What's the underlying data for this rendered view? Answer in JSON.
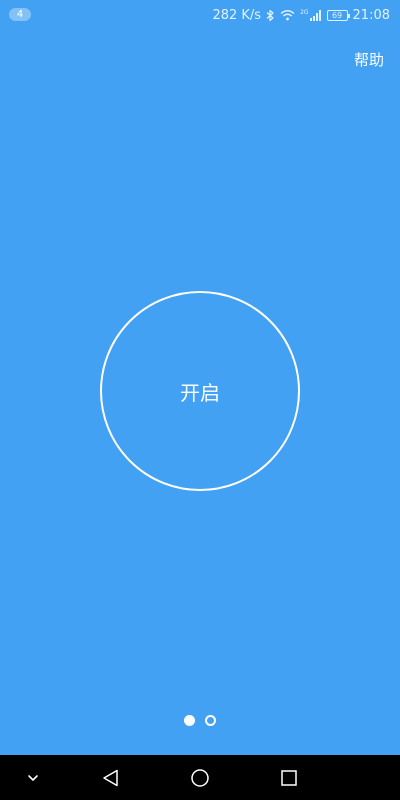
{
  "status_bar": {
    "notification_count": "4",
    "net_speed": "282 K/s",
    "network_type": "2G",
    "battery_level": "69",
    "time": "21:08",
    "icons": [
      "bluetooth-icon",
      "wifi-icon",
      "signal-icon",
      "battery-icon"
    ]
  },
  "header": {
    "help_label": "帮助"
  },
  "main": {
    "power_button_label": "开启"
  },
  "pager": {
    "page_count": 2,
    "active_index": 0
  },
  "nav_bar": {
    "icons": [
      "chevron-down-icon",
      "back-icon",
      "home-icon",
      "recents-icon"
    ]
  },
  "colors": {
    "background": "#42a1f2",
    "foreground": "#ffffff",
    "nav_bar": "#000000"
  }
}
